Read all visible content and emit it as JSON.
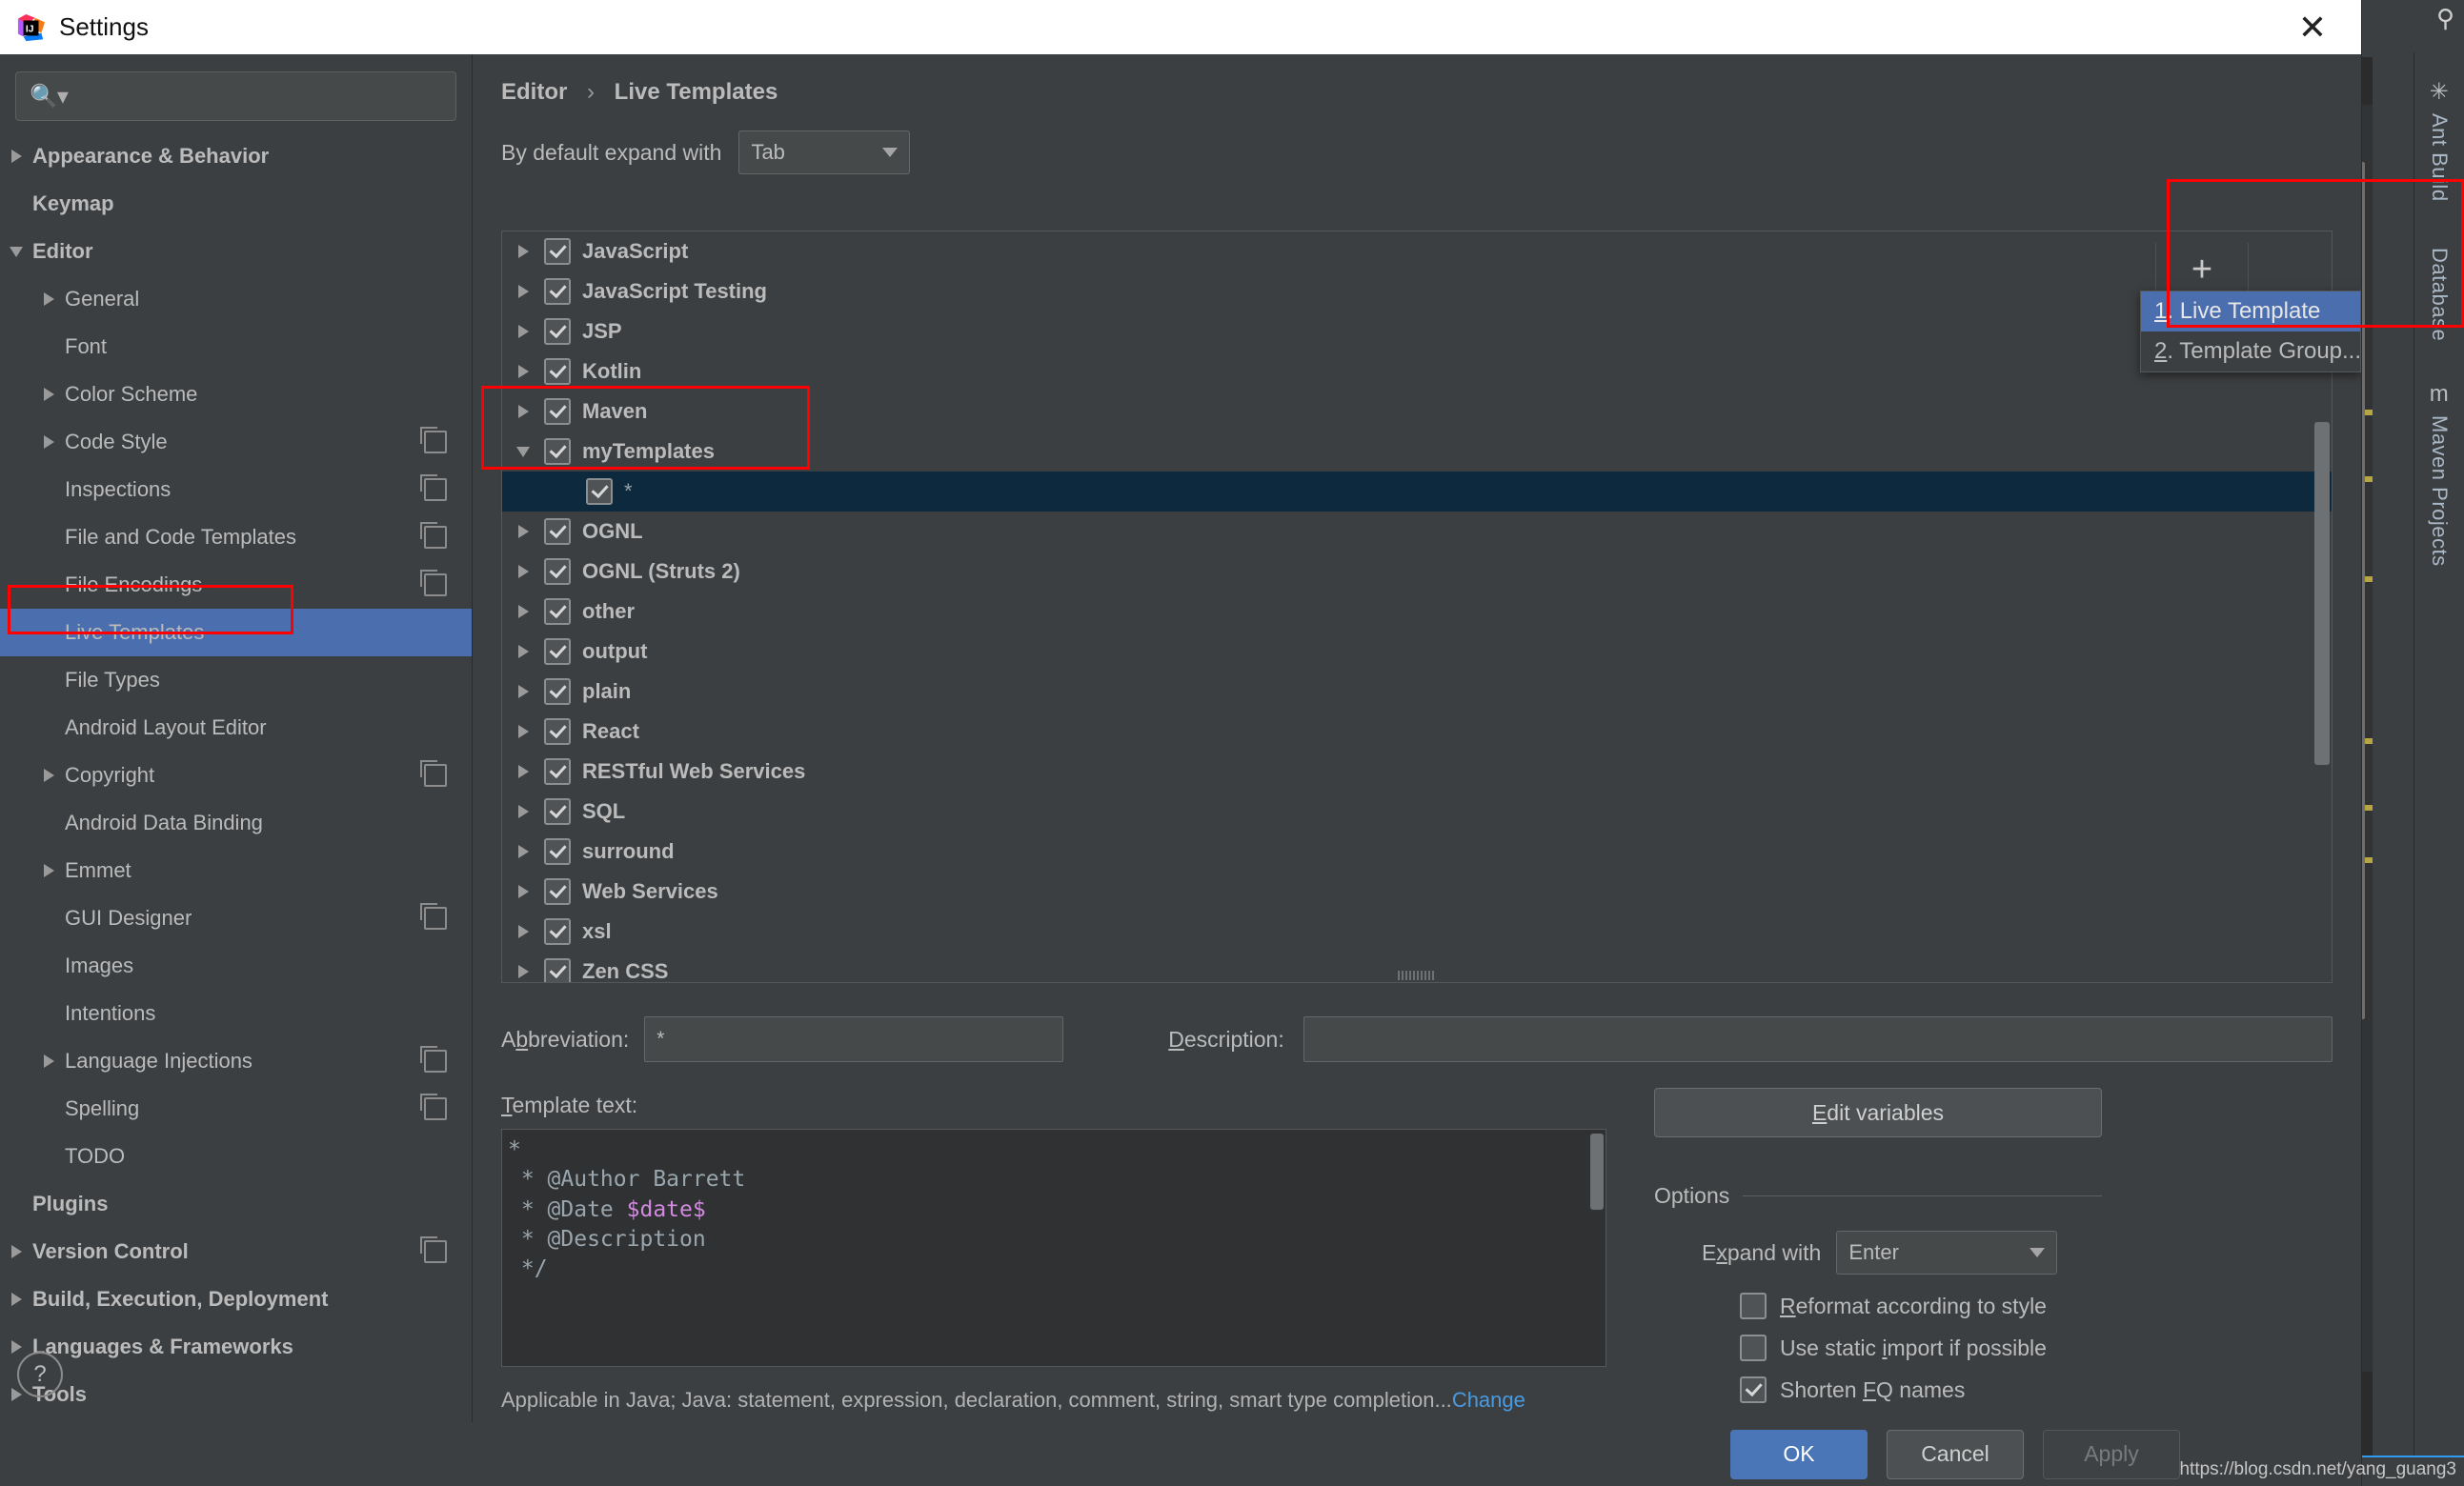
{
  "window": {
    "title": "Settings",
    "close_label": "✕"
  },
  "sidebar": {
    "search": {
      "placeholder": "",
      "value": "",
      "icon": "search-icon"
    },
    "help_label": "?",
    "items": [
      {
        "label": "Appearance & Behavior",
        "level": 0,
        "arrow": "right",
        "bold": true,
        "copy": false,
        "selected": false
      },
      {
        "label": "Keymap",
        "level": 0,
        "arrow": "none",
        "bold": true,
        "copy": false,
        "selected": false
      },
      {
        "label": "Editor",
        "level": 0,
        "arrow": "down",
        "bold": true,
        "copy": false,
        "selected": false
      },
      {
        "label": "General",
        "level": 1,
        "arrow": "right",
        "bold": false,
        "copy": false,
        "selected": false
      },
      {
        "label": "Font",
        "level": 1,
        "arrow": "none",
        "bold": false,
        "copy": false,
        "selected": false
      },
      {
        "label": "Color Scheme",
        "level": 1,
        "arrow": "right",
        "bold": false,
        "copy": false,
        "selected": false
      },
      {
        "label": "Code Style",
        "level": 1,
        "arrow": "right",
        "bold": false,
        "copy": true,
        "selected": false
      },
      {
        "label": "Inspections",
        "level": 1,
        "arrow": "none",
        "bold": false,
        "copy": true,
        "selected": false
      },
      {
        "label": "File and Code Templates",
        "level": 1,
        "arrow": "none",
        "bold": false,
        "copy": true,
        "selected": false
      },
      {
        "label": "File Encodings",
        "level": 1,
        "arrow": "none",
        "bold": false,
        "copy": true,
        "selected": false
      },
      {
        "label": "Live Templates",
        "level": 1,
        "arrow": "none",
        "bold": false,
        "copy": false,
        "selected": true
      },
      {
        "label": "File Types",
        "level": 1,
        "arrow": "none",
        "bold": false,
        "copy": false,
        "selected": false
      },
      {
        "label": "Android Layout Editor",
        "level": 1,
        "arrow": "none",
        "bold": false,
        "copy": false,
        "selected": false
      },
      {
        "label": "Copyright",
        "level": 1,
        "arrow": "right",
        "bold": false,
        "copy": true,
        "selected": false
      },
      {
        "label": "Android Data Binding",
        "level": 1,
        "arrow": "none",
        "bold": false,
        "copy": false,
        "selected": false
      },
      {
        "label": "Emmet",
        "level": 1,
        "arrow": "right",
        "bold": false,
        "copy": false,
        "selected": false
      },
      {
        "label": "GUI Designer",
        "level": 1,
        "arrow": "none",
        "bold": false,
        "copy": true,
        "selected": false
      },
      {
        "label": "Images",
        "level": 1,
        "arrow": "none",
        "bold": false,
        "copy": false,
        "selected": false
      },
      {
        "label": "Intentions",
        "level": 1,
        "arrow": "none",
        "bold": false,
        "copy": false,
        "selected": false
      },
      {
        "label": "Language Injections",
        "level": 1,
        "arrow": "right",
        "bold": false,
        "copy": true,
        "selected": false
      },
      {
        "label": "Spelling",
        "level": 1,
        "arrow": "none",
        "bold": false,
        "copy": true,
        "selected": false
      },
      {
        "label": "TODO",
        "level": 1,
        "arrow": "none",
        "bold": false,
        "copy": false,
        "selected": false
      },
      {
        "label": "Plugins",
        "level": 0,
        "arrow": "none",
        "bold": true,
        "copy": false,
        "selected": false
      },
      {
        "label": "Version Control",
        "level": 0,
        "arrow": "right",
        "bold": true,
        "copy": true,
        "selected": false
      },
      {
        "label": "Build, Execution, Deployment",
        "level": 0,
        "arrow": "right",
        "bold": true,
        "copy": false,
        "selected": false
      },
      {
        "label": "Languages & Frameworks",
        "level": 0,
        "arrow": "right",
        "bold": true,
        "copy": false,
        "selected": false
      },
      {
        "label": "Tools",
        "level": 0,
        "arrow": "right",
        "bold": true,
        "copy": false,
        "selected": false
      }
    ]
  },
  "main": {
    "breadcrumb": {
      "parent": "Editor",
      "separator": "›",
      "current": "Live Templates"
    },
    "expand_with": {
      "label": "By default expand with",
      "value": "Tab"
    },
    "template_tree": [
      {
        "label": "JavaScript",
        "arrow": "right",
        "checked": true,
        "child": false,
        "selected": false
      },
      {
        "label": "JavaScript Testing",
        "arrow": "right",
        "checked": true,
        "child": false,
        "selected": false
      },
      {
        "label": "JSP",
        "arrow": "right",
        "checked": true,
        "child": false,
        "selected": false
      },
      {
        "label": "Kotlin",
        "arrow": "right",
        "checked": true,
        "child": false,
        "selected": false
      },
      {
        "label": "Maven",
        "arrow": "right",
        "checked": true,
        "child": false,
        "selected": false
      },
      {
        "label": "myTemplates",
        "arrow": "down",
        "checked": true,
        "child": false,
        "selected": false
      },
      {
        "label": "*",
        "arrow": "none",
        "checked": true,
        "child": true,
        "selected": true
      },
      {
        "label": "OGNL",
        "arrow": "right",
        "checked": true,
        "child": false,
        "selected": false
      },
      {
        "label": "OGNL (Struts 2)",
        "arrow": "right",
        "checked": true,
        "child": false,
        "selected": false
      },
      {
        "label": "other",
        "arrow": "right",
        "checked": true,
        "child": false,
        "selected": false
      },
      {
        "label": "output",
        "arrow": "right",
        "checked": true,
        "child": false,
        "selected": false
      },
      {
        "label": "plain",
        "arrow": "right",
        "checked": true,
        "child": false,
        "selected": false
      },
      {
        "label": "React",
        "arrow": "right",
        "checked": true,
        "child": false,
        "selected": false
      },
      {
        "label": "RESTful Web Services",
        "arrow": "right",
        "checked": true,
        "child": false,
        "selected": false
      },
      {
        "label": "SQL",
        "arrow": "right",
        "checked": true,
        "child": false,
        "selected": false
      },
      {
        "label": "surround",
        "arrow": "right",
        "checked": true,
        "child": false,
        "selected": false
      },
      {
        "label": "Web Services",
        "arrow": "right",
        "checked": true,
        "child": false,
        "selected": false
      },
      {
        "label": "xsl",
        "arrow": "right",
        "checked": true,
        "child": false,
        "selected": false
      },
      {
        "label": "Zen CSS",
        "arrow": "right",
        "checked": true,
        "child": false,
        "selected": false
      }
    ],
    "add_button": {
      "label": "+"
    },
    "add_menu": [
      {
        "mnemonic": "1",
        "label": ". Live Template",
        "selected": true
      },
      {
        "mnemonic": "2",
        "label": ". Template Group...",
        "selected": false
      }
    ],
    "abbreviation": {
      "label_pre": "A",
      "label_mn": "b",
      "label_post": "breviation:",
      "value": "*"
    },
    "description": {
      "label_pre": "",
      "label_mn": "D",
      "label_post": "escription:",
      "value": ""
    },
    "template_text_label": {
      "mn": "T",
      "rest": "emplate text:"
    },
    "template_text_lines": [
      {
        "text": "*",
        "var": ""
      },
      {
        "text": " * @Author Barrett",
        "var": ""
      },
      {
        "text": " * @Date ",
        "var": "$date$"
      },
      {
        "text": " * @Description",
        "var": ""
      },
      {
        "text": " */",
        "var": ""
      }
    ],
    "edit_variables": {
      "mn": "E",
      "rest": "dit variables"
    },
    "options": {
      "title": "Options",
      "expand_with": {
        "label_pre": "E",
        "label_mn": "x",
        "label_post": "pand with",
        "value": "Enter"
      },
      "checkboxes": [
        {
          "label_pre": "",
          "mn": "R",
          "label_post": "eformat according to style",
          "checked": false
        },
        {
          "label_pre": "Use static ",
          "mn": "i",
          "label_post": "mport if possible",
          "checked": false
        },
        {
          "label_pre": "Shorten ",
          "mn": "F",
          "label_post": "Q names",
          "checked": true
        }
      ]
    },
    "applicable": {
      "text": "Applicable in Java; Java: statement, expression, declaration, comment, string, smart type completion...",
      "link": "Change"
    }
  },
  "buttons": {
    "ok": "OK",
    "cancel": "Cancel",
    "apply": "Apply"
  },
  "ide_background": {
    "tool_windows": [
      {
        "label": "Ant Build",
        "icon": "✳"
      },
      {
        "label": "Database",
        "icon": ""
      },
      {
        "label": "Maven Projects",
        "icon": "m"
      }
    ]
  },
  "watermark": "https://blog.csdn.net/yang_guang3",
  "colors": {
    "accent_blue": "#4b6eaf",
    "primary_button": "#4a76b8",
    "selection_dark": "#0d293e",
    "link": "#4a9ae0",
    "annotation_red": "#ff0000",
    "panel_bg": "#3c3f41",
    "editor_bg": "#2f3133",
    "text": "#bbbbbb"
  }
}
